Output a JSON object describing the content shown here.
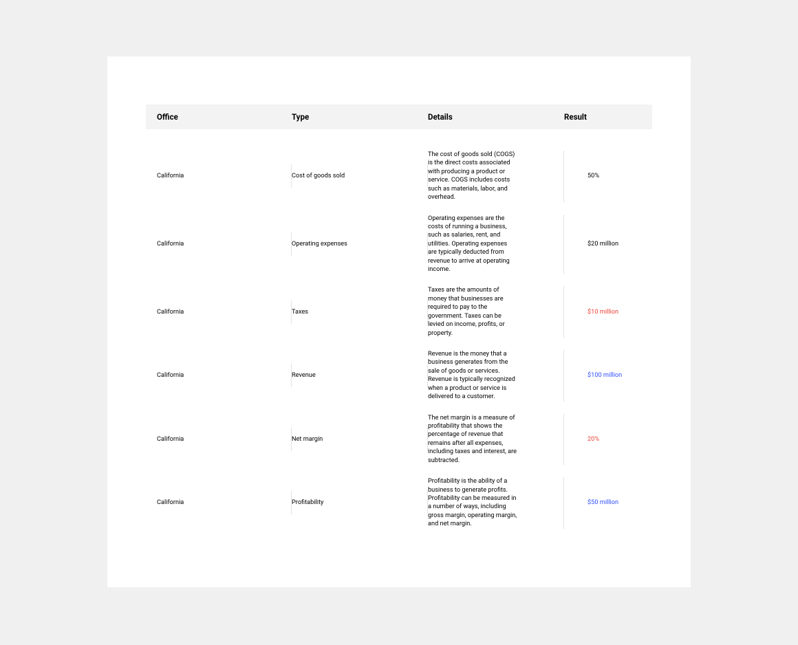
{
  "columns": {
    "office": "Office",
    "type": "Type",
    "details": "Details",
    "result": "Result"
  },
  "rows": [
    {
      "office": "California",
      "type": "Cost of goods sold",
      "details": "The cost of goods sold (COGS) is the direct costs associated with producing a product or service. COGS includes costs such as materials, labor, and overhead.",
      "result": "50%",
      "result_color": "default"
    },
    {
      "office": "California",
      "type": "Operating expenses",
      "details": "Operating expenses are the costs of running a business, such as salaries, rent, and utilities. Operating expenses are typically deducted from revenue to arrive at operating income.",
      "result": "$20 million",
      "result_color": "default"
    },
    {
      "office": "California",
      "type": "Taxes",
      "details": "Taxes are the amounts of money that businesses are required to pay to the government. Taxes can be levied on income, profits, or property.",
      "result": "$10 million",
      "result_color": "red"
    },
    {
      "office": "California",
      "type": "Revenue",
      "details": "Revenue is the money that a business generates from the sale of goods or services. Revenue is typically recognized when a product or service is delivered to a customer.",
      "result": "$100 million",
      "result_color": "blue"
    },
    {
      "office": "California",
      "type": "Net margin",
      "details": "The net margin is a measure of profitability that shows the percentage of revenue that remains after all expenses, including taxes and interest, are subtracted.",
      "result": "20%",
      "result_color": "red"
    },
    {
      "office": "California",
      "type": "Profitability",
      "details": "Profitability is the ability of a business to generate profits. Profitability can be measured in a number of ways, including gross margin, operating margin, and net margin.",
      "result": "$50 million",
      "result_color": "blue"
    }
  ]
}
